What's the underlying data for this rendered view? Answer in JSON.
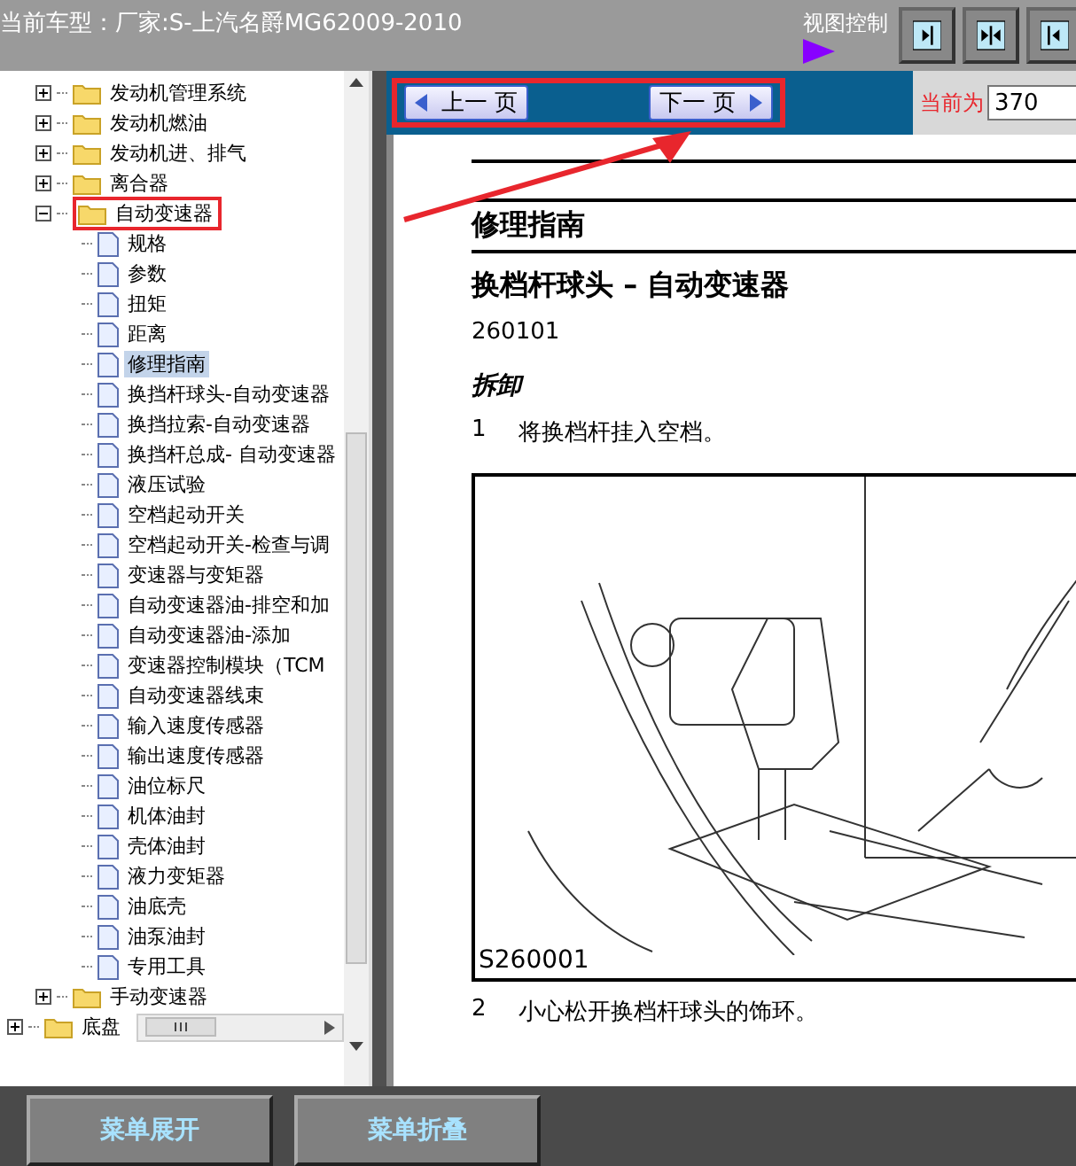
{
  "header": {
    "title": "当前车型：厂家:S-上汽名爵MG62009-2010",
    "view_control_label": "视图控制"
  },
  "tree": {
    "items": [
      {
        "label": "发动机管理系统",
        "expanded": false,
        "selected": false,
        "marked": false
      },
      {
        "label": "发动机燃油",
        "expanded": false,
        "selected": false,
        "marked": false
      },
      {
        "label": "发动机进、排气",
        "expanded": false,
        "selected": false,
        "marked": false
      },
      {
        "label": "离合器",
        "expanded": false,
        "selected": false,
        "marked": false
      },
      {
        "label": "自动变速器",
        "expanded": true,
        "selected": false,
        "marked": true,
        "children": [
          {
            "label": "规格",
            "selected": false
          },
          {
            "label": "参数",
            "selected": false
          },
          {
            "label": "扭矩",
            "selected": false
          },
          {
            "label": "距离",
            "selected": false
          },
          {
            "label": "修理指南",
            "selected": true
          },
          {
            "label": "换挡杆球头-自动变速器",
            "selected": false
          },
          {
            "label": "换挡拉索-自动变速器",
            "selected": false
          },
          {
            "label": "换挡杆总成- 自动变速器",
            "selected": false
          },
          {
            "label": "液压试验",
            "selected": false
          },
          {
            "label": "空档起动开关",
            "selected": false
          },
          {
            "label": "空档起动开关-检查与调",
            "selected": false
          },
          {
            "label": "变速器与变矩器",
            "selected": false
          },
          {
            "label": "自动变速器油-排空和加",
            "selected": false
          },
          {
            "label": "自动变速器油-添加",
            "selected": false
          },
          {
            "label": "变速器控制模块（TCM",
            "selected": false
          },
          {
            "label": "自动变速器线束",
            "selected": false
          },
          {
            "label": "输入速度传感器",
            "selected": false
          },
          {
            "label": "输出速度传感器",
            "selected": false
          },
          {
            "label": "油位标尺",
            "selected": false
          },
          {
            "label": "机体油封",
            "selected": false
          },
          {
            "label": "壳体油封",
            "selected": false
          },
          {
            "label": "液力变矩器",
            "selected": false
          },
          {
            "label": "油底壳",
            "selected": false
          },
          {
            "label": "油泵油封",
            "selected": false
          },
          {
            "label": "专用工具",
            "selected": false
          }
        ]
      },
      {
        "label": "手动变速器",
        "expanded": false,
        "selected": false,
        "marked": false
      },
      {
        "label": "底盘",
        "expanded": false,
        "selected": false,
        "marked": false
      }
    ]
  },
  "nav": {
    "prev": "上一 页",
    "next": "下一 页",
    "current_label": "当前为",
    "current_value": "370",
    "marked": true
  },
  "document": {
    "section": "修理指南",
    "title": "换档杆球头 – 自动变速器",
    "code": "260101",
    "subheading": "拆卸",
    "steps": [
      {
        "number": "1",
        "text": "将换档杆挂入空档。"
      }
    ],
    "figure": {
      "caption": "S260001"
    },
    "steps_after": [
      {
        "number": "2",
        "text": "小心松开换档杆球头的饰环。"
      }
    ]
  },
  "bottom_buttons": [
    "菜单展开",
    "菜单折叠"
  ]
}
